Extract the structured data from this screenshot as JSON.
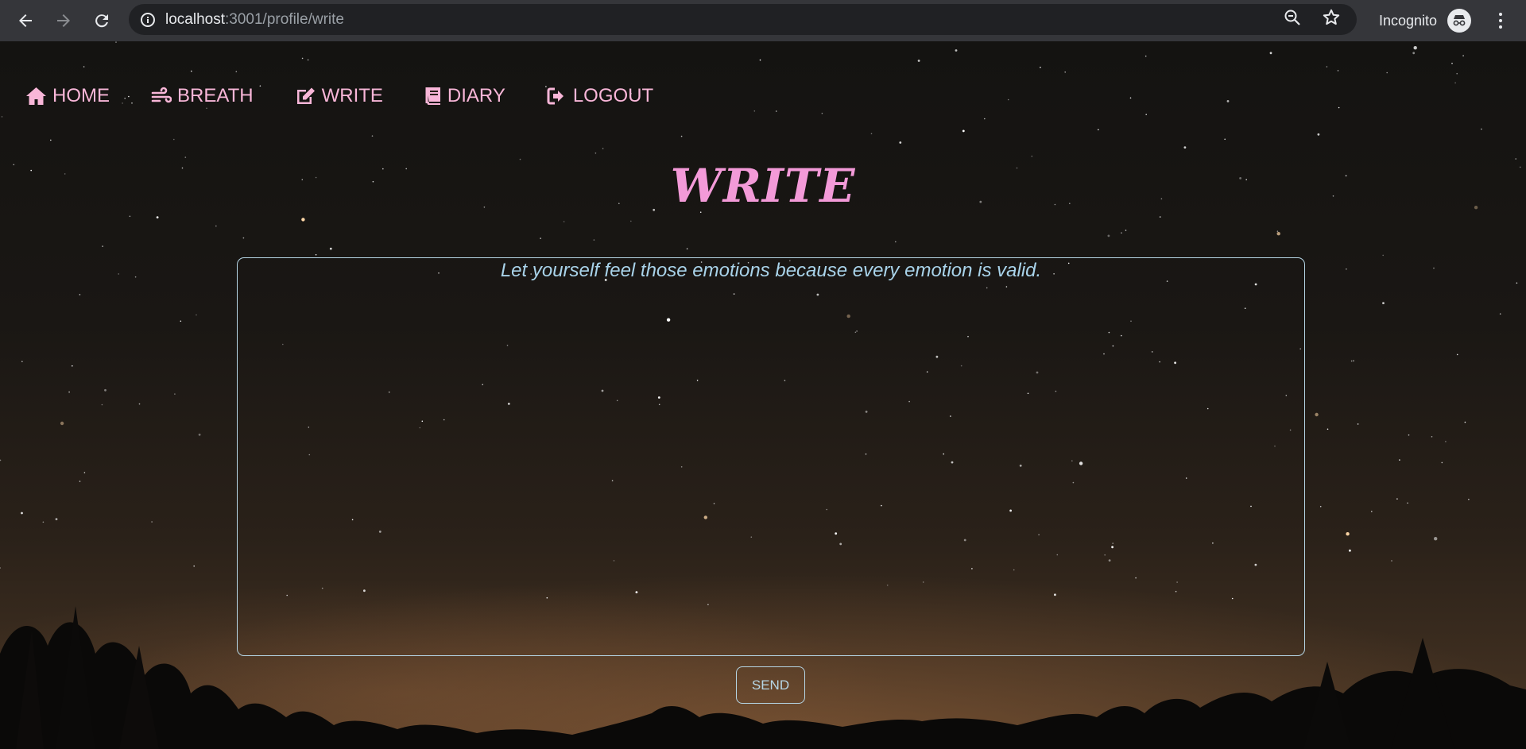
{
  "browser": {
    "url_host": "localhost",
    "url_rest": ":3001/profile/write",
    "profile_label": "Incognito",
    "icons": [
      "back-icon",
      "forward-icon",
      "reload-icon",
      "info-icon",
      "zoom-icon",
      "star-icon",
      "incognito-icon",
      "more-icon"
    ]
  },
  "nav": {
    "items": [
      {
        "label": "HOME",
        "icon": "home-icon"
      },
      {
        "label": "BREATH",
        "icon": "wind-icon"
      },
      {
        "label": "WRITE",
        "icon": "edit-icon"
      },
      {
        "label": "DIARY",
        "icon": "book-icon"
      },
      {
        "label": "LOGOUT",
        "icon": "logout-icon"
      }
    ]
  },
  "page": {
    "title": "WRITE",
    "textarea_placeholder": "Let yourself feel those emotions because every emotion is valid.",
    "textarea_value": "",
    "send_label": "SEND"
  },
  "colors": {
    "nav_text": "#f8b6d8",
    "title": "#f39ad8",
    "input_border": "#b6d6e6",
    "placeholder": "#a9d3ea",
    "chrome_bg": "#35363a",
    "omnibox_bg": "#202124"
  }
}
